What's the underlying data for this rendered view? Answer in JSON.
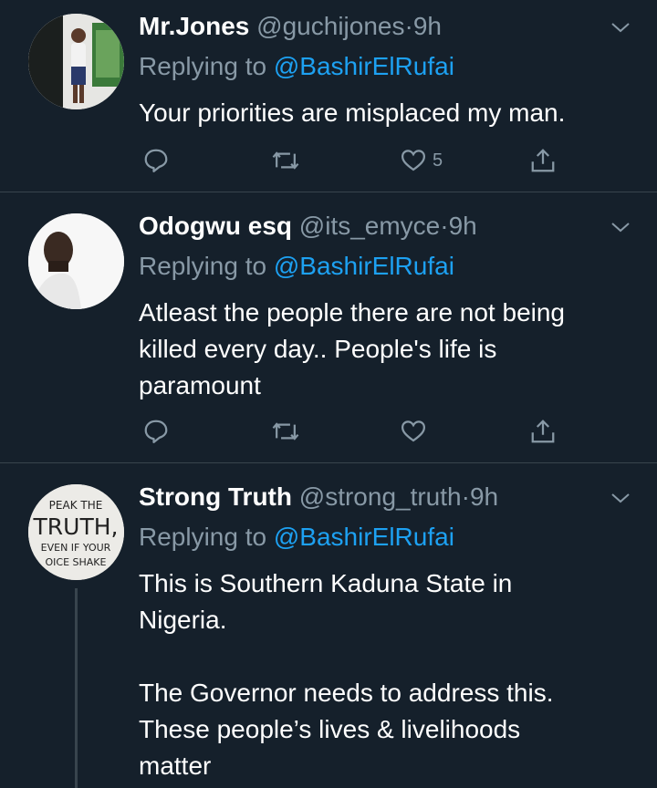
{
  "tweets": [
    {
      "name": "Mr.Jones",
      "handle": "@guchijones",
      "sep": "·",
      "time": "9h",
      "replying_prefix": "Replying to",
      "replying_to": "@BashirElRufai",
      "text": "Your priorities are misplaced my man.",
      "like_count": "5"
    },
    {
      "name": "Odogwu esq",
      "handle": "@its_emyce",
      "sep": "·",
      "time": "9h",
      "replying_prefix": "Replying to",
      "replying_to": "@BashirElRufai",
      "text": "Atleast the people there are not being\nkilled every day.. People's life is\nparamount",
      "like_count": ""
    },
    {
      "name": "Strong Truth",
      "handle": "@strong_truth",
      "sep": "·",
      "time": "9h",
      "replying_prefix": "Replying to",
      "replying_to": "@BashirElRufai",
      "text": "This is Southern Kaduna State in\nNigeria.\n\nThe Governor needs to address this.\nThese people’s lives & livelihoods\nmatter",
      "avatar_text": [
        "PEAK THE",
        "TRUTH,",
        "EVEN IF YOUR",
        "OICE SHAKE"
      ]
    }
  ],
  "colors": {
    "background": "#15202b",
    "secondary_text": "#8899a6",
    "link": "#1da1f2",
    "divider": "#38444d"
  }
}
